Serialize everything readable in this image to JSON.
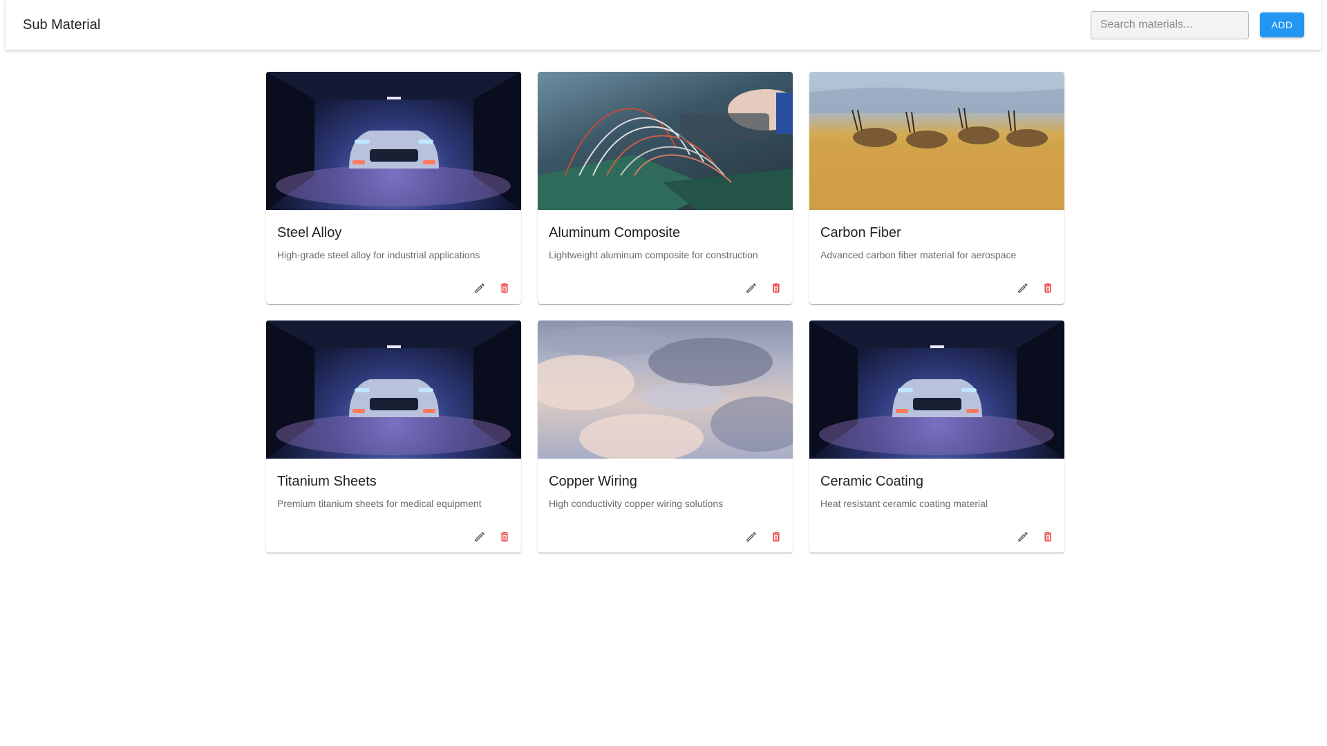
{
  "header": {
    "title": "Sub Material",
    "search_placeholder": "Search materials...",
    "add_label": "ADD"
  },
  "materials": [
    {
      "name": "Steel Alloy",
      "description": "High-grade steel alloy for industrial applications",
      "image": "car-garage-photo"
    },
    {
      "name": "Aluminum Composite",
      "description": "Lightweight aluminum composite for construction",
      "image": "circuit-wires-photo"
    },
    {
      "name": "Carbon Fiber",
      "description": "Advanced carbon fiber material for aerospace",
      "image": "antelope-savanna-photo"
    },
    {
      "name": "Titanium Sheets",
      "description": "Premium titanium sheets for medical equipment",
      "image": "car-garage-photo"
    },
    {
      "name": "Copper Wiring",
      "description": "High conductivity copper wiring solutions",
      "image": "clouds-sky-photo"
    },
    {
      "name": "Ceramic Coating",
      "description": "Heat resistant ceramic coating material",
      "image": "car-garage-photo"
    }
  ],
  "icons": {
    "edit": "pencil-icon",
    "delete": "trash-icon"
  },
  "colors": {
    "accent": "#2196f3",
    "delete": "#e53935",
    "edit": "#616161"
  }
}
